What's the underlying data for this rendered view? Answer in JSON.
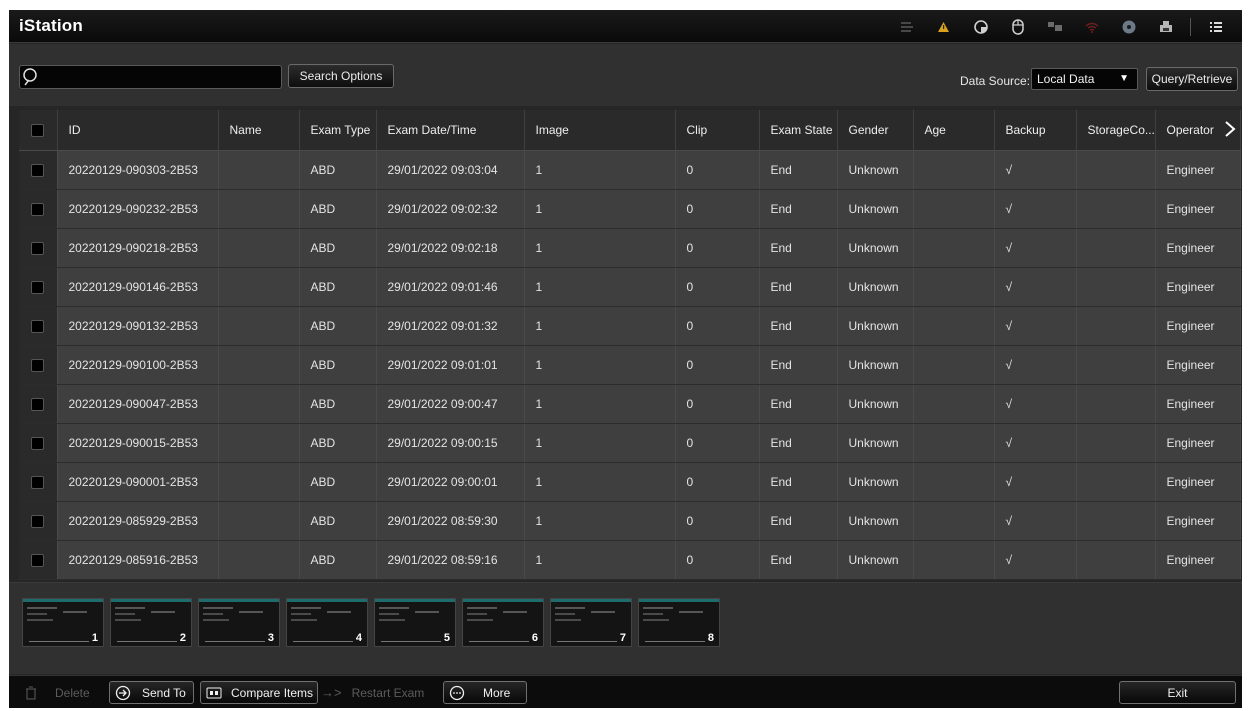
{
  "app": {
    "title": "iStation"
  },
  "search": {
    "value": "",
    "placeholder": ""
  },
  "toolbar": {
    "search_options_label": "Search Options",
    "data_source_label": "Data Source:",
    "data_source_value": "Local Data",
    "query_retrieve_label": "Query/Retrieve"
  },
  "status_icons": [
    "list-icon",
    "warning-icon",
    "network-icon",
    "mouse-icon",
    "storage-icon",
    "wifi-icon",
    "dvd-icon",
    "printer-icon",
    "menu-icon"
  ],
  "table": {
    "columns": [
      "ID",
      "Name",
      "Exam Type",
      "Exam Date/Time",
      "Image",
      "Clip",
      "Exam State",
      "Gender",
      "Age",
      "Backup",
      "StorageCo...",
      "Operator"
    ],
    "rows": [
      {
        "id": "20220129-090303-2B53",
        "name": "",
        "exam_type": "ABD",
        "exam_datetime": "29/01/2022 09:03:04",
        "image": "1",
        "clip": "0",
        "exam_state": "End",
        "gender": "Unknown",
        "age": "",
        "backup": "√",
        "storage": "",
        "operator": "Engineer"
      },
      {
        "id": "20220129-090232-2B53",
        "name": "",
        "exam_type": "ABD",
        "exam_datetime": "29/01/2022 09:02:32",
        "image": "1",
        "clip": "0",
        "exam_state": "End",
        "gender": "Unknown",
        "age": "",
        "backup": "√",
        "storage": "",
        "operator": "Engineer"
      },
      {
        "id": "20220129-090218-2B53",
        "name": "",
        "exam_type": "ABD",
        "exam_datetime": "29/01/2022 09:02:18",
        "image": "1",
        "clip": "0",
        "exam_state": "End",
        "gender": "Unknown",
        "age": "",
        "backup": "√",
        "storage": "",
        "operator": "Engineer"
      },
      {
        "id": "20220129-090146-2B53",
        "name": "",
        "exam_type": "ABD",
        "exam_datetime": "29/01/2022 09:01:46",
        "image": "1",
        "clip": "0",
        "exam_state": "End",
        "gender": "Unknown",
        "age": "",
        "backup": "√",
        "storage": "",
        "operator": "Engineer"
      },
      {
        "id": "20220129-090132-2B53",
        "name": "",
        "exam_type": "ABD",
        "exam_datetime": "29/01/2022 09:01:32",
        "image": "1",
        "clip": "0",
        "exam_state": "End",
        "gender": "Unknown",
        "age": "",
        "backup": "√",
        "storage": "",
        "operator": "Engineer"
      },
      {
        "id": "20220129-090100-2B53",
        "name": "",
        "exam_type": "ABD",
        "exam_datetime": "29/01/2022 09:01:01",
        "image": "1",
        "clip": "0",
        "exam_state": "End",
        "gender": "Unknown",
        "age": "",
        "backup": "√",
        "storage": "",
        "operator": "Engineer"
      },
      {
        "id": "20220129-090047-2B53",
        "name": "",
        "exam_type": "ABD",
        "exam_datetime": "29/01/2022 09:00:47",
        "image": "1",
        "clip": "0",
        "exam_state": "End",
        "gender": "Unknown",
        "age": "",
        "backup": "√",
        "storage": "",
        "operator": "Engineer"
      },
      {
        "id": "20220129-090015-2B53",
        "name": "",
        "exam_type": "ABD",
        "exam_datetime": "29/01/2022 09:00:15",
        "image": "1",
        "clip": "0",
        "exam_state": "End",
        "gender": "Unknown",
        "age": "",
        "backup": "√",
        "storage": "",
        "operator": "Engineer"
      },
      {
        "id": "20220129-090001-2B53",
        "name": "",
        "exam_type": "ABD",
        "exam_datetime": "29/01/2022 09:00:01",
        "image": "1",
        "clip": "0",
        "exam_state": "End",
        "gender": "Unknown",
        "age": "",
        "backup": "√",
        "storage": "",
        "operator": "Engineer"
      },
      {
        "id": "20220129-085929-2B53",
        "name": "",
        "exam_type": "ABD",
        "exam_datetime": "29/01/2022 08:59:30",
        "image": "1",
        "clip": "0",
        "exam_state": "End",
        "gender": "Unknown",
        "age": "",
        "backup": "√",
        "storage": "",
        "operator": "Engineer"
      },
      {
        "id": "20220129-085916-2B53",
        "name": "",
        "exam_type": "ABD",
        "exam_datetime": "29/01/2022 08:59:16",
        "image": "1",
        "clip": "0",
        "exam_state": "End",
        "gender": "Unknown",
        "age": "",
        "backup": "√",
        "storage": "",
        "operator": "Engineer"
      }
    ]
  },
  "thumbnails": [
    {
      "number": "1"
    },
    {
      "number": "2"
    },
    {
      "number": "3"
    },
    {
      "number": "4"
    },
    {
      "number": "5"
    },
    {
      "number": "6"
    },
    {
      "number": "7"
    },
    {
      "number": "8"
    }
  ],
  "bottom_bar": {
    "delete_label": "Delete",
    "send_to_label": "Send To",
    "compare_items_label": "Compare Items",
    "restart_exam_label": "Restart Exam",
    "more_label": "More",
    "exit_label": "Exit"
  },
  "colors": {
    "background": "#262626",
    "title_bar": "#0a0a0a",
    "row": "#3f3f3f",
    "warning": "#d8a21c",
    "thumbnail_accent": "#1e6b6b"
  }
}
